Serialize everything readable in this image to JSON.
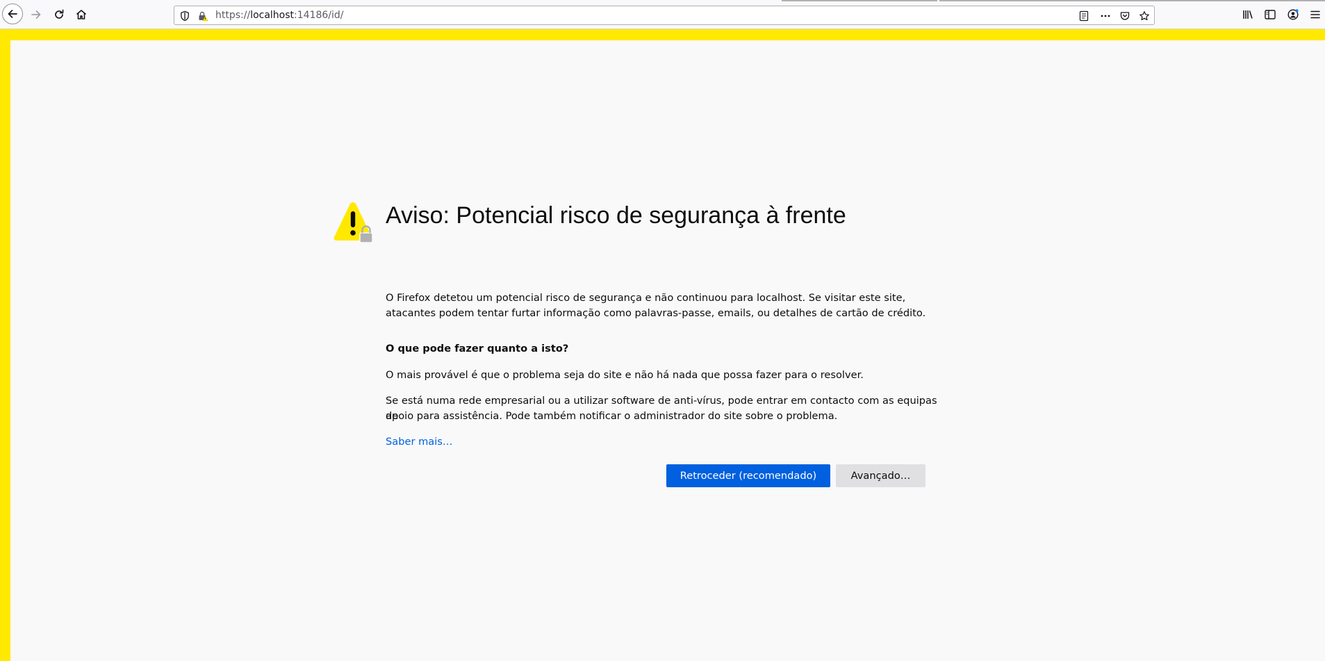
{
  "url": {
    "prefix": "https://",
    "host": "localhost",
    "rest": ":14186/id/"
  },
  "error": {
    "title": "Aviso: Potencial risco de segurança à frente",
    "intro_line1": "O Firefox detetou um potencial risco de segurança e não continuou para localhost. Se visitar este site,",
    "intro_line2": "atacantes podem tentar furtar informação como palavras-passe, emails, ou detalhes de cartão de crédito.",
    "what_heading": "O que pode fazer quanto a isto?",
    "likely": "O mais provável é que o problema seja do site e não há nada que possa fazer para o resolver.",
    "network_line1": "Se está numa rede empresarial ou a utilizar software de anti-vírus, pode entrar em contacto com as equipas de",
    "network_line2": "apoio para assistência. Pode também notificar o administrador do site sobre o problema.",
    "learn_more": "Saber mais…",
    "go_back_button": "Retroceder (recomendado)",
    "advanced_button": "Avançado…"
  },
  "colors": {
    "frame_warning": "#ffe900",
    "primary": "#0060df",
    "link": "#0060df",
    "warning_yellow": "#ffe900"
  },
  "icons": {
    "nav": [
      "back-icon",
      "forward-icon",
      "reload-icon",
      "home-icon"
    ],
    "urlbar": [
      "tracking-protection-shield-icon",
      "insecure-lock-warning-icon",
      "reader-view-icon",
      "page-actions-icon",
      "pocket-icon",
      "bookmark-star-icon"
    ],
    "right": [
      "library-icon",
      "sidebar-icon",
      "account-icon",
      "menu-icon"
    ]
  }
}
